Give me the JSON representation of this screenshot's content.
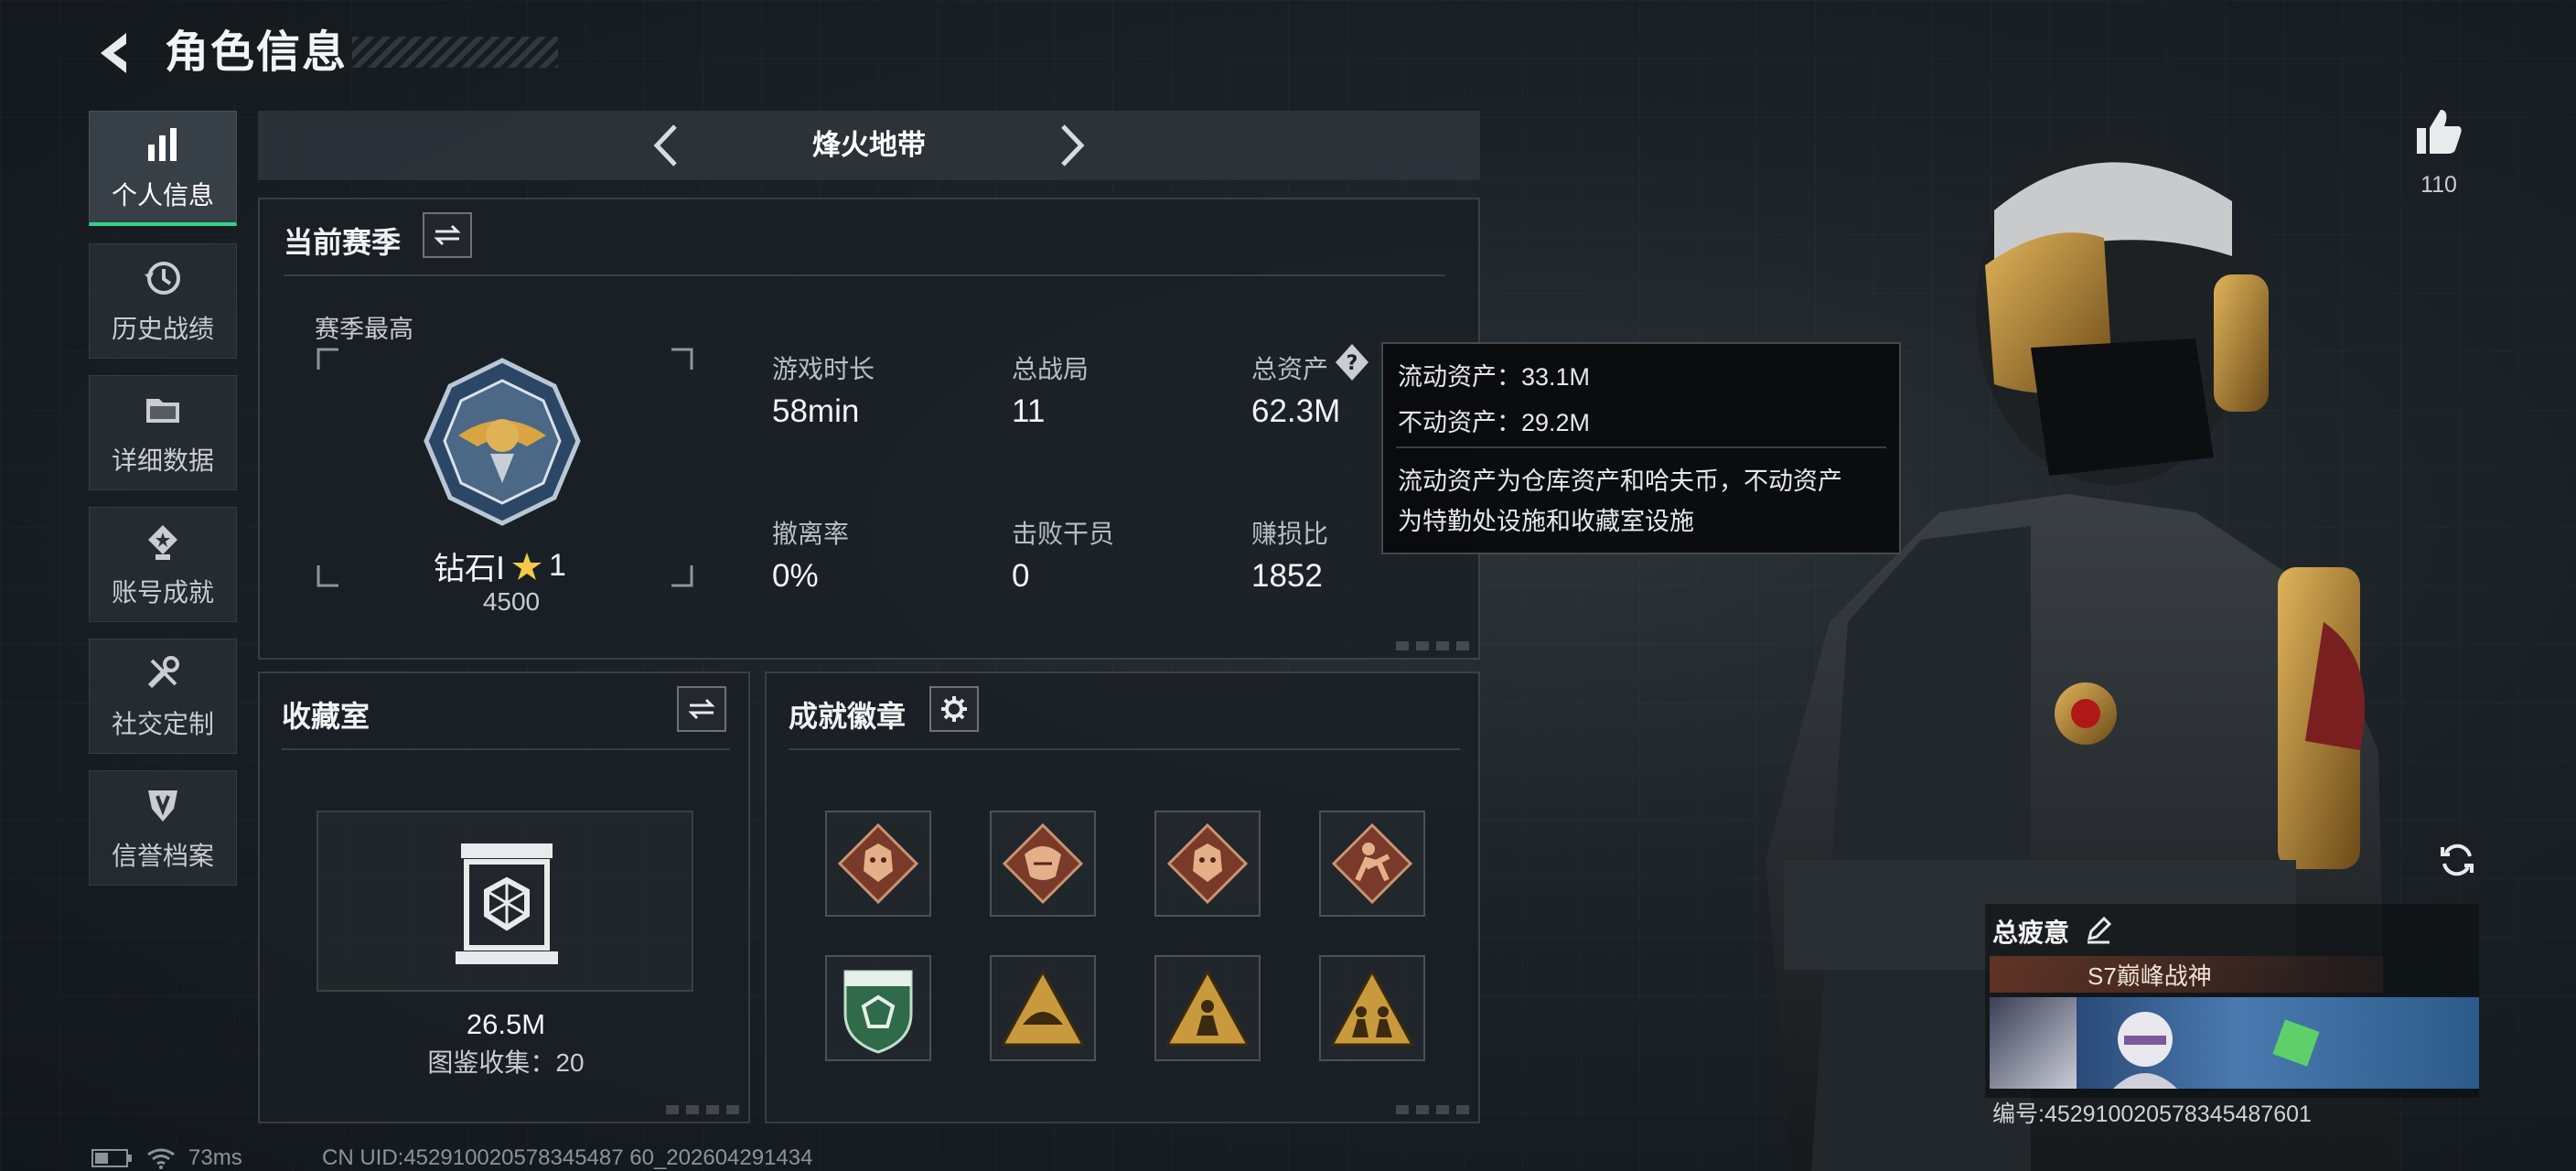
{
  "header": {
    "title": "角色信息"
  },
  "sidebar": {
    "items": [
      {
        "label": "个人信息",
        "icon": "bar-chart-icon",
        "active": true
      },
      {
        "label": "历史战绩",
        "icon": "history-clock-icon",
        "active": false
      },
      {
        "label": "详细数据",
        "icon": "folder-icon",
        "active": false
      },
      {
        "label": "账号成就",
        "icon": "achievement-medal-icon",
        "active": false
      },
      {
        "label": "社交定制",
        "icon": "wrench-tools-icon",
        "active": false
      },
      {
        "label": "信誉档案",
        "icon": "shield-emblem-icon",
        "active": false
      }
    ]
  },
  "mode_selector": {
    "title": "烽火地带"
  },
  "season_panel": {
    "title": "当前赛季",
    "best_label": "赛季最高",
    "rank_name": "钻石Ⅰ",
    "rank_stars": "1",
    "rank_points": "4500",
    "stats": [
      {
        "label": "游戏时长",
        "value": "58min"
      },
      {
        "label": "总战局",
        "value": "11"
      },
      {
        "label": "总资产",
        "value": "62.3M"
      },
      {
        "label": "撤离率",
        "value": "0%"
      },
      {
        "label": "击败干员",
        "value": "0"
      },
      {
        "label": "赚损比",
        "value": "1852"
      }
    ]
  },
  "asset_tooltip": {
    "liquid": "流动资产：33.1M",
    "fixed": "不动资产：29.2M",
    "desc_line1": "流动资产为仓库资产和哈夫币，不动资产",
    "desc_line2": "为特勤处设施和收藏室设施"
  },
  "collection_panel": {
    "title": "收藏室",
    "value": "26.5M",
    "count_text": "图鉴收集：20"
  },
  "badges_panel": {
    "title": "成就徽章",
    "badges": [
      "wolf-badge-icon",
      "dragon-badge-icon",
      "wolf-badge-icon",
      "soldier-badge-icon",
      "green-shield-badge-icon",
      "triangle-helmet-badge-icon",
      "triangle-figure-badge-icon",
      "triangle-squad-badge-icon"
    ]
  },
  "profile": {
    "like_count": "110",
    "fatigue_label": "总疲意",
    "season_title": "S7巅峰战神",
    "id_text": "编号:452910020578345487601"
  },
  "status": {
    "ping": "73ms",
    "uid": "CN UID:452910020578345487 60_202604291434"
  },
  "colors": {
    "accent": "#2fd48a",
    "panel_bg": "#1a2026",
    "gold": "#c99a3d"
  }
}
